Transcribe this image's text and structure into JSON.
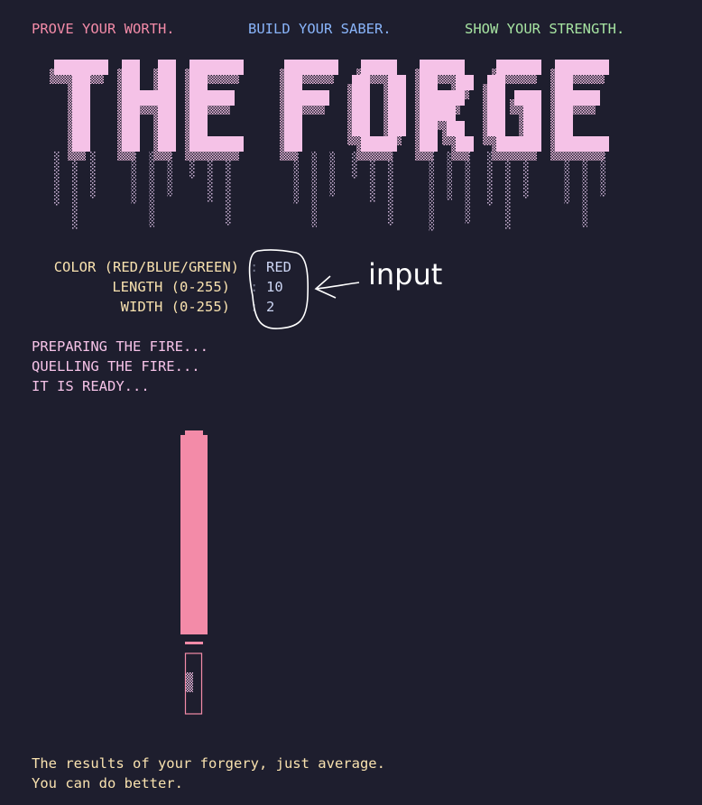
{
  "taglines": [
    "PROVE YOUR WORTH.",
    "BUILD YOUR SABER.",
    "SHOW YOUR STRENGTH."
  ],
  "banner": {
    "text": "THE FORGE",
    "color": "#f5c2e7"
  },
  "params": [
    {
      "label": "COLOR (RED/BLUE/GREEN)",
      "value": "RED"
    },
    {
      "label": "LENGTH (0-255)",
      "value": "10"
    },
    {
      "label": "WIDTH (0-255)",
      "value": "2"
    }
  ],
  "annotation": {
    "text": "input"
  },
  "messages": [
    "PREPARING THE FIRE...",
    "QUELLING THE FIRE...",
    "IT IS READY..."
  ],
  "saber": {
    "blade_color": "#f38ba8"
  },
  "result": [
    "The results of your forgery, just average.",
    "You can do better."
  ],
  "colors": {
    "background": "#1e1e2e",
    "pink": "#f38ba8",
    "blue": "#89b4fa",
    "green": "#a6e3a1",
    "yellow": "#f9e2af",
    "lavender": "#f5c2e7"
  }
}
